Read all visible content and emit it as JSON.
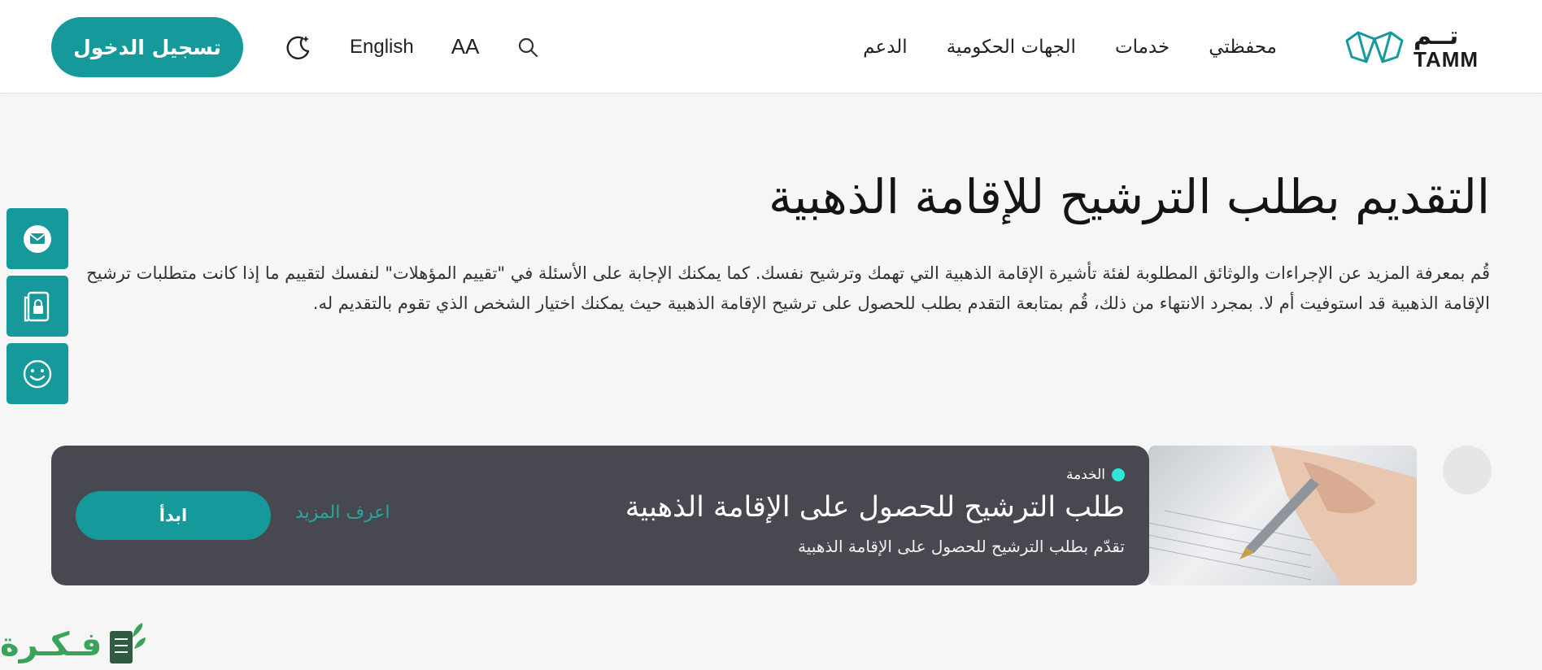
{
  "header": {
    "logo": {
      "ar": "تــم",
      "en": "TAMM"
    },
    "nav": [
      "محفظتي",
      "خدمات",
      "الجهات الحكومية",
      "الدعم"
    ],
    "font_size_label": "AA",
    "language_label": "English",
    "login_label": "تسجيل الدخول"
  },
  "side_bar": {
    "icons": [
      "mail-icon",
      "lock-document-icon",
      "smiley-icon"
    ]
  },
  "page": {
    "title": "التقديم بطلب الترشيح للإقامة الذهبية",
    "description": "قُم بمعرفة المزيد عن الإجراءات والوثائق المطلوبة لفئة تأشيرة الإقامة الذهبية التي تهمك وترشيح نفسك. كما يمكنك الإجابة على الأسئلة في \"تقييم المؤهلات\" لنفسك لتقييم ما إذا كانت متطلبات ترشيح الإقامة الذهبية قد استوفيت أم لا. بمجرد الانتهاء من ذلك، قُم بمتابعة التقدم بطلب للحصول على ترشيح الإقامة الذهبية حيث يمكنك اختيار الشخص الذي تقوم بالتقديم له."
  },
  "service_card": {
    "label": "الخدمة",
    "title": "طلب الترشيح للحصول على الإقامة الذهبية",
    "subtitle": "تقدّم بطلب الترشيح للحصول على الإقامة الذهبية",
    "learn_more": "اعرف المزيد",
    "start": "ابدأ"
  },
  "watermark": {
    "text": "فـكـرة"
  },
  "colors": {
    "primary": "#16999a",
    "card_bg": "#484850",
    "accent_dot": "#2ee6d8",
    "link": "#2aa6a0"
  }
}
